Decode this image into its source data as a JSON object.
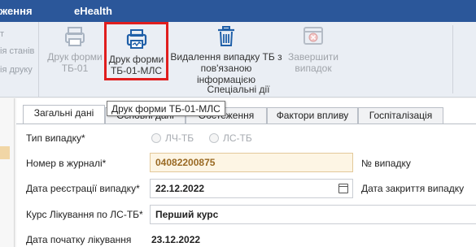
{
  "menubar": {
    "item_partial": "ження",
    "item_ehealth": "eHealth"
  },
  "ribbon": {
    "left_stub": {
      "line1": "т",
      "line2": "ія станів",
      "line3": "ія друку"
    },
    "buttons": [
      {
        "label_line1": "Друк форми",
        "label_line2": "ТБ-01",
        "icon": "printer-icon",
        "state": "disabled"
      },
      {
        "label_line1": "Друк форми",
        "label_line2": "ТБ-01-МЛС",
        "icon": "printer-icon",
        "state": "highlighted"
      },
      {
        "label_line1": "Видалення випадку ТБ з",
        "label_line2": "пов'язаною інформацією",
        "icon": "trash-icon",
        "state": "enabled"
      },
      {
        "label_line1": "Завершити",
        "label_line2": "випадок",
        "icon": "close-window-icon",
        "state": "disabled"
      }
    ],
    "group_label": "Спеціальні дії"
  },
  "tooltip": "Друк форми ТБ-01-МЛС",
  "tabs": [
    "Загальні дані",
    "Основні дані",
    "Обстеження",
    "Фактори впливу",
    "Госпіталізація"
  ],
  "form": {
    "case_type_label": "Тип випадку*",
    "case_type_options": [
      "ЛЧ-ТБ",
      "ЛС-ТБ"
    ],
    "journal_number_label": "Номер в журналі*",
    "journal_number_value": "04082200875",
    "case_number_label": "№ випадку",
    "registration_date_label": "Дата реєстрації  випадку*",
    "registration_date_value": "22.12.2022",
    "closing_date_label": "Дата закриття  випадку",
    "treatment_course_label": "Курс Лікування по ЛС-ТБ*",
    "treatment_course_value": "Перший курс",
    "treatment_start_label": "Дата початку лікування",
    "treatment_start_value": "23.12.2022"
  },
  "colors": {
    "menubar": "#2b579a",
    "highlight_border": "#e01e1e",
    "accent_icon": "#1f5fa8"
  }
}
